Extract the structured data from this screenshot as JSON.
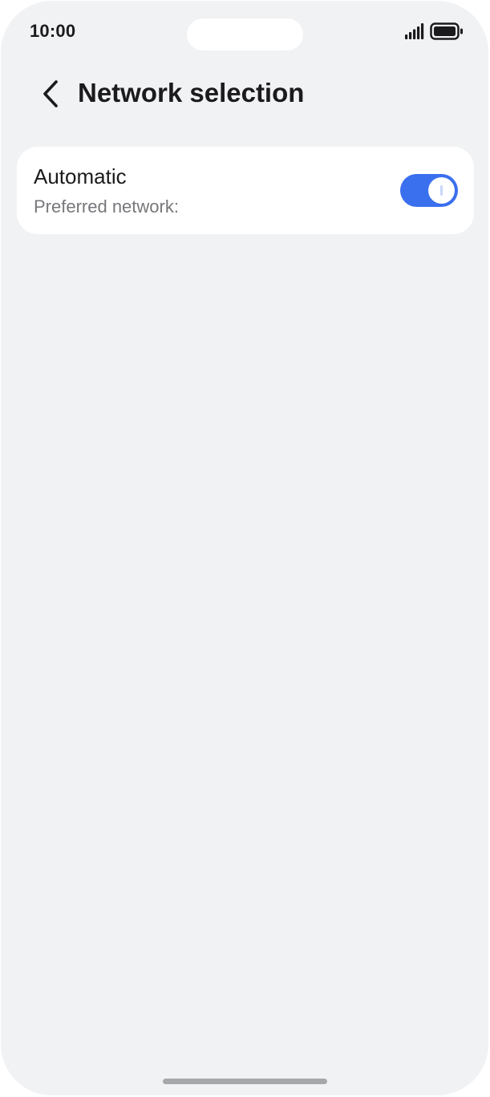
{
  "status_bar": {
    "time": "10:00",
    "icons": [
      "signal-icon",
      "battery-icon"
    ]
  },
  "header": {
    "back_icon": "chevron-left-icon",
    "title": "Network selection"
  },
  "settings": {
    "automatic": {
      "title": "Automatic",
      "subtitle": "Preferred network:",
      "enabled": true
    }
  },
  "colors": {
    "background": "#f1f2f4",
    "card": "#ffffff",
    "accent": "#3a6fee",
    "primary_text": "#1b1b1d",
    "secondary_text": "#76777b"
  }
}
